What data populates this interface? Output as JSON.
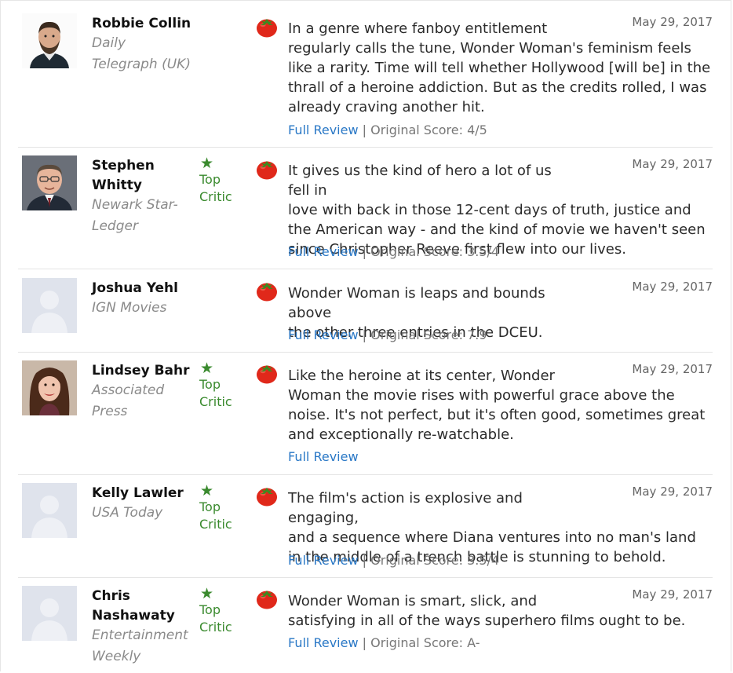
{
  "reviews": [
    {
      "critic": "Robbie Collin",
      "publication": "Daily Telegraph (UK)",
      "top_critic": false,
      "date": "May 29, 2017",
      "quote_first": "In a genre where fanboy entitlement",
      "quote_rest": "regularly calls the tune, Wonder Woman's feminism feels like a rarity. Time will tell whether Hollywood [will be] in the thrall of a heroine addiction. But as the credits rolled, I was already craving another hit.",
      "full_review_label": "Full Review",
      "score_text": "Original Score: 4/5",
      "avatar": "photo-man-beard"
    },
    {
      "critic": "Stephen Whitty",
      "publication": "Newark Star-Ledger",
      "top_critic": true,
      "top_critic_label": "Top Critic",
      "date": "May 29, 2017",
      "quote_first": "It gives us the kind of hero a lot of us fell in",
      "quote_rest": "love with back in those 12-cent days of truth, justice and the American way - and the kind of movie we haven't seen since Christopher Reeve first flew into our lives.",
      "full_review_label": "Full Review",
      "score_text": "Original Score: 3.5/4",
      "avatar": "photo-man-glasses"
    },
    {
      "critic": "Joshua Yehl",
      "publication": "IGN Movies",
      "top_critic": false,
      "date": "May 29, 2017",
      "quote_first": "Wonder Woman is leaps and bounds above",
      "quote_rest": "the other three entries in the DCEU.",
      "full_review_label": "Full Review",
      "score_text": "Original Score: 7.9",
      "avatar": "placeholder"
    },
    {
      "critic": "Lindsey Bahr",
      "publication": "Associated Press",
      "top_critic": true,
      "top_critic_label": "Top Critic",
      "date": "May 29, 2017",
      "quote_first": "Like the heroine at its center, Wonder",
      "quote_rest": "Woman the movie rises with powerful grace above the noise. It's not perfect, but it's often good, sometimes great and exceptionally re-watchable.",
      "full_review_label": "Full Review",
      "score_text": "",
      "avatar": "photo-woman"
    },
    {
      "critic": "Kelly Lawler",
      "publication": "USA Today",
      "top_critic": true,
      "top_critic_label": "Top Critic",
      "date": "May 29, 2017",
      "quote_first": "The film's action is explosive and engaging,",
      "quote_rest": "and a sequence where Diana ventures into no man's land in the middle of a trench battle is stunning to behold.",
      "full_review_label": "Full Review",
      "score_text": "Original Score: 3.5/4",
      "avatar": "placeholder"
    },
    {
      "critic": "Chris Nashawaty",
      "publication": "Entertainment Weekly",
      "top_critic": true,
      "top_critic_label": "Top Critic",
      "date": "May 29, 2017",
      "quote_first": "Wonder Woman is smart, slick, and",
      "quote_rest": "satisfying in all of the ways superhero films ought to be.",
      "full_review_label": "Full Review",
      "score_text": "Original Score: A-",
      "avatar": "placeholder"
    }
  ],
  "separator": "|",
  "colors": {
    "top_critic_green": "#3a8a2e",
    "link_blue": "#2a78c6",
    "tomato_red": "#e0281a"
  },
  "icons": {
    "fresh": "fresh-tomato-icon",
    "star": "star-icon"
  }
}
